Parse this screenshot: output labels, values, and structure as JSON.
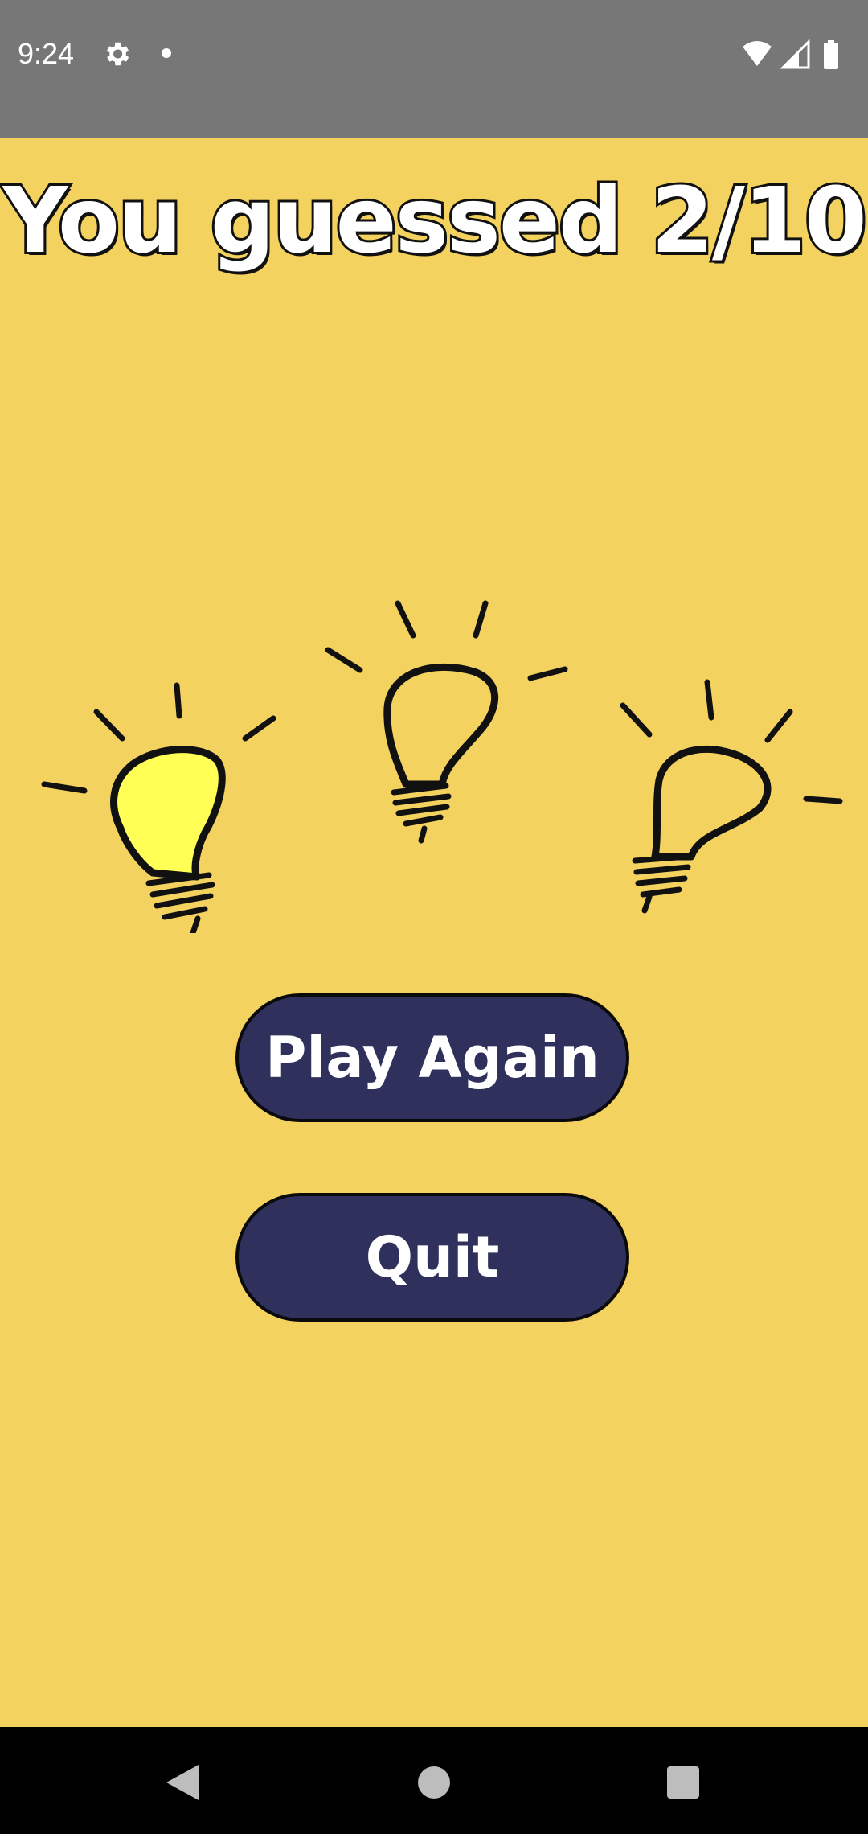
{
  "status_bar": {
    "time": "9:24",
    "icons": [
      "gear-icon",
      "notification-dot-icon",
      "wifi-icon",
      "signal-icon",
      "battery-icon"
    ]
  },
  "game": {
    "result_title": "You guessed 2/10",
    "bulbs": [
      {
        "state": "lit",
        "color": "#ffff55"
      },
      {
        "state": "unlit",
        "color": "#f3d25f"
      },
      {
        "state": "unlit",
        "color": "#f3d25f"
      }
    ]
  },
  "buttons": {
    "play_again": "Play Again",
    "quit": "Quit"
  },
  "colors": {
    "background": "#f3d25f",
    "button": "#2f305b",
    "status_bar": "#777777",
    "lit_bulb": "#ffff55"
  },
  "nav_bar": {
    "icons": [
      "back-icon",
      "home-icon",
      "recents-icon"
    ]
  }
}
